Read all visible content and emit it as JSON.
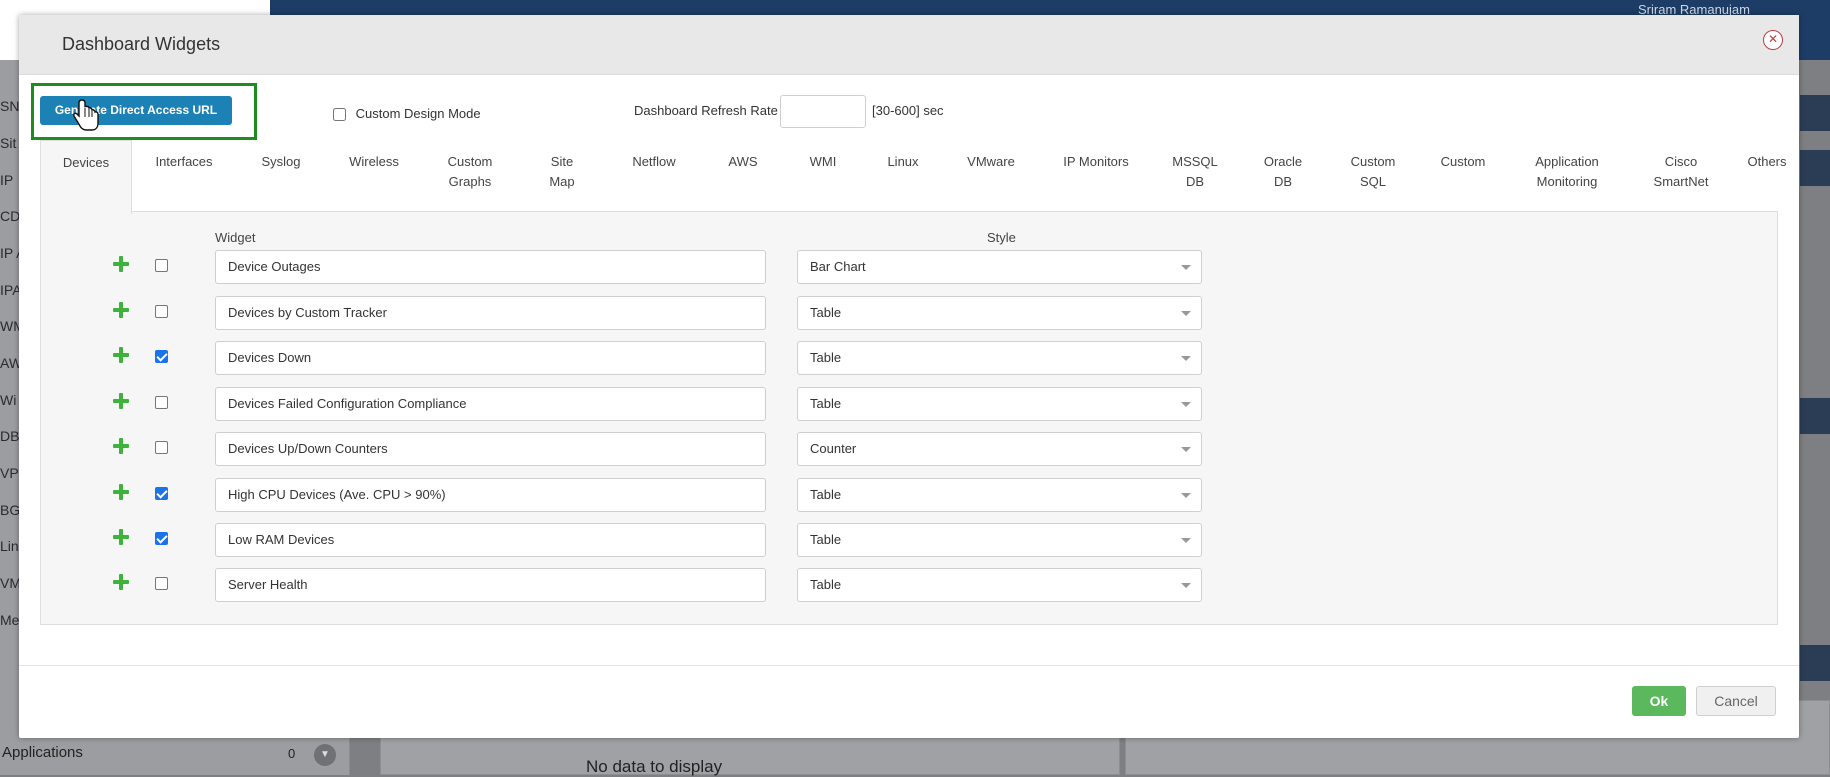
{
  "background": {
    "user_name": "Sriram Ramanujam",
    "sidebar_items": [
      "SN",
      "Sit",
      "IP",
      "CD",
      "IP A",
      "IPA",
      "WM",
      "AW",
      "Wi",
      "DB",
      "VP",
      "BG",
      "Lin",
      "VM",
      "Me"
    ],
    "applications_label": "Applications",
    "applications_count": "0",
    "no_data_text": "No data to display"
  },
  "modal": {
    "title": "Dashboard Widgets",
    "generate_url_label": "Generate Direct Access URL",
    "custom_design_mode_label": "Custom Design Mode",
    "refresh_rate_label": "Dashboard Refresh Rate",
    "refresh_rate_value": "",
    "refresh_rate_hint": "[30-600] sec",
    "tabs": [
      {
        "label": "Devices",
        "active": true
      },
      {
        "label": "Interfaces"
      },
      {
        "label": "Syslog"
      },
      {
        "label": "Wireless"
      },
      {
        "label": "Custom\nGraphs"
      },
      {
        "label": "Site\nMap"
      },
      {
        "label": "Netflow"
      },
      {
        "label": "AWS"
      },
      {
        "label": "WMI"
      },
      {
        "label": "Linux"
      },
      {
        "label": "VMware"
      },
      {
        "label": "IP Monitors"
      },
      {
        "label": "MSSQL\nDB"
      },
      {
        "label": "Oracle\nDB"
      },
      {
        "label": "Custom\nSQL"
      },
      {
        "label": "Custom"
      },
      {
        "label": "Application\nMonitoring"
      },
      {
        "label": "Cisco\nSmartNet"
      },
      {
        "label": "Others"
      }
    ],
    "columns": {
      "widget": "Widget",
      "style": "Style"
    },
    "rows": [
      {
        "widget": "Device Outages",
        "style": "Bar Chart",
        "checked": false
      },
      {
        "widget": "Devices by Custom Tracker",
        "style": "Table",
        "checked": false
      },
      {
        "widget": "Devices Down",
        "style": "Table",
        "checked": true
      },
      {
        "widget": "Devices Failed Configuration Compliance",
        "style": "Table",
        "checked": false
      },
      {
        "widget": "Devices Up/Down Counters",
        "style": "Counter",
        "checked": false
      },
      {
        "widget": "High CPU Devices (Ave. CPU > 90%)",
        "style": "Table",
        "checked": true
      },
      {
        "widget": "Low RAM Devices",
        "style": "Table",
        "checked": true
      },
      {
        "widget": "Server Health",
        "style": "Table",
        "checked": false
      }
    ],
    "ok_label": "Ok",
    "cancel_label": "Cancel"
  },
  "colors": {
    "primary_button": "#1c81b5",
    "ok_button": "#5cb85c",
    "highlight_box": "#1e8c1e",
    "plus_icon": "#3eb23a"
  }
}
